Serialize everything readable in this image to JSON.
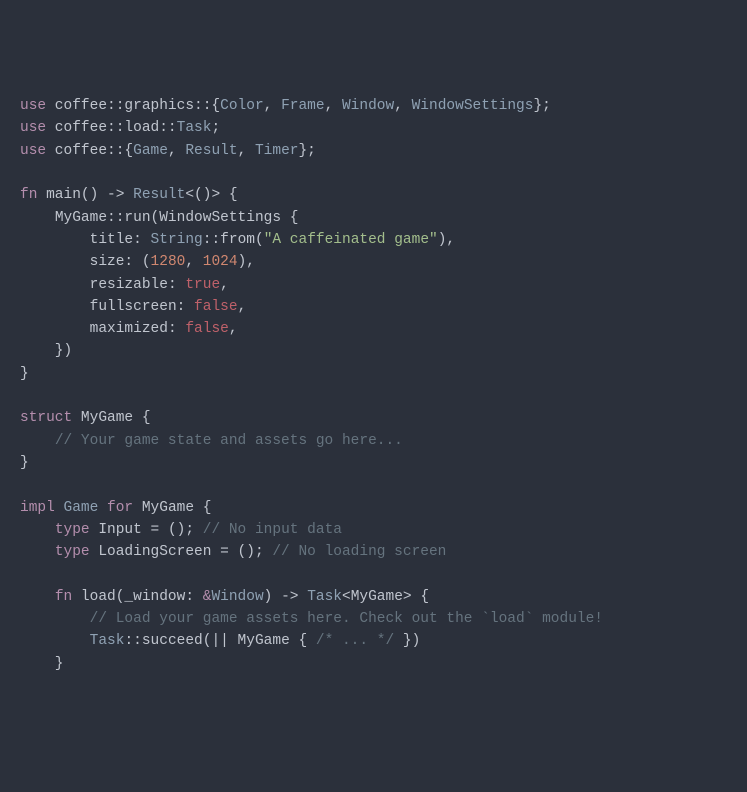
{
  "lines": {
    "l1_use": "use",
    "l1_path": " coffee::graphics::{",
    "l1_t1": "Color",
    "l1_c1": ", ",
    "l1_t2": "Frame",
    "l1_c2": ", ",
    "l1_t3": "Window",
    "l1_c3": ", ",
    "l1_t4": "WindowSettings",
    "l1_end": "};",
    "l2_use": "use",
    "l2_path": " coffee::load::",
    "l2_t1": "Task",
    "l2_end": ";",
    "l3_use": "use",
    "l3_path": " coffee::{",
    "l3_t1": "Game",
    "l3_c1": ", ",
    "l3_t2": "Result",
    "l3_c2": ", ",
    "l3_t3": "Timer",
    "l3_end": "};",
    "l5_fn": "fn",
    "l5_name": " main() -> ",
    "l5_ret": "Result",
    "l5_gen": "<()> {",
    "l6_indent": "    ",
    "l6_call": "MyGame::run(",
    "l6_struct": "WindowSettings",
    "l6_brace": " {",
    "l7_indent": "        ",
    "l7_field": "title: ",
    "l7_ty": "String",
    "l7_from": "::from(",
    "l7_str": "\"A caffeinated game\"",
    "l7_end": "),",
    "l8_indent": "        ",
    "l8_field": "size: (",
    "l8_n1": "1280",
    "l8_c": ", ",
    "l8_n2": "1024",
    "l8_end": "),",
    "l9_indent": "        ",
    "l9_field": "resizable: ",
    "l9_val": "true",
    "l9_end": ",",
    "l10_indent": "        ",
    "l10_field": "fullscreen: ",
    "l10_val": "false",
    "l10_end": ",",
    "l11_indent": "        ",
    "l11_field": "maximized: ",
    "l11_val": "false",
    "l11_end": ",",
    "l12": "    })",
    "l13": "}",
    "l15_kw": "struct",
    "l15_name": " MyGame {",
    "l16_indent": "    ",
    "l16_comment": "// Your game state and assets go here...",
    "l17": "}",
    "l19_impl": "impl",
    "l19_sp1": " ",
    "l19_trait": "Game",
    "l19_sp2": " ",
    "l19_for": "for",
    "l19_sp3": " ",
    "l19_ty": "MyGame",
    "l19_brace": " {",
    "l20_indent": "    ",
    "l20_kw": "type",
    "l20_name": " Input = (); ",
    "l20_comment": "// No input data",
    "l21_indent": "    ",
    "l21_kw": "type",
    "l21_name": " LoadingScreen = (); ",
    "l21_comment": "// No loading screen",
    "l23_indent": "    ",
    "l23_fn": "fn",
    "l23_name": " load(_window: ",
    "l23_amp": "&",
    "l23_win": "Window",
    "l23_arrow": ") -> ",
    "l23_task": "Task",
    "l23_gen1": "<",
    "l23_mg": "MyGame",
    "l23_gen2": "> {",
    "l24_indent": "        ",
    "l24_comment": "// Load your game assets here. Check out the `load` module!",
    "l25_indent": "        ",
    "l25_task": "Task",
    "l25_succ": "::succeed(|| MyGame { ",
    "l25_cmt": "/* ... */",
    "l25_end": " })",
    "l26": "    }"
  }
}
